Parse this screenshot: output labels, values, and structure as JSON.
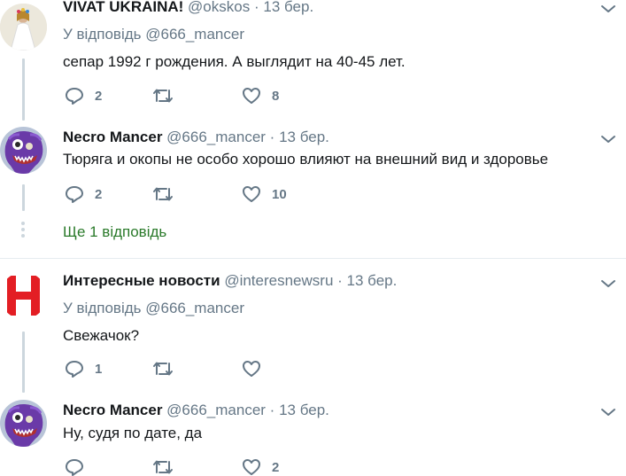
{
  "tweets": [
    {
      "author": "VIVAT UKRAINA!",
      "handle": "@okskos",
      "sep": "·",
      "date": "13 бер.",
      "reply_prefix": "У відповідь",
      "reply_mention": "@666_mancer",
      "text": "сепар 1992 г рождения. А выглядит на 40-45 лет.",
      "replies": "2",
      "retweets": "",
      "likes": "8",
      "avatar": "woman-in-white-dress"
    },
    {
      "author": "Necro Mancer",
      "handle": "@666_mancer",
      "sep": "·",
      "date": "13 бер.",
      "text": "Тюряга и окопы не особо хорошо влияют на внешний вид и здоровье",
      "replies": "2",
      "retweets": "",
      "likes": "10",
      "avatar": "purple-monster"
    },
    {
      "author": "Интересные новости",
      "handle": "@interesnewsru",
      "sep": "·",
      "date": "13 бер.",
      "reply_prefix": "У відповідь",
      "reply_mention": "@666_mancer",
      "text": "Свежачок?",
      "replies": "1",
      "retweets": "",
      "likes": "",
      "avatar": "red-h-logo"
    },
    {
      "author": "Necro Mancer",
      "handle": "@666_mancer",
      "sep": "·",
      "date": "13 бер.",
      "text": "Ну, судя по дате, да",
      "replies": "",
      "retweets": "",
      "likes": "2",
      "avatar": "purple-monster"
    }
  ],
  "more_replies": "Ще 1 відповідь",
  "colors": {
    "text": "#14171a",
    "muted": "#657786",
    "link": "#2a7a2a",
    "thread_line": "#ccd6dd",
    "divider": "#e6ecf0",
    "avatar_red": "#e31e24"
  },
  "icons": [
    "reply-icon",
    "retweet-icon",
    "like-icon",
    "chevron-down-icon"
  ]
}
